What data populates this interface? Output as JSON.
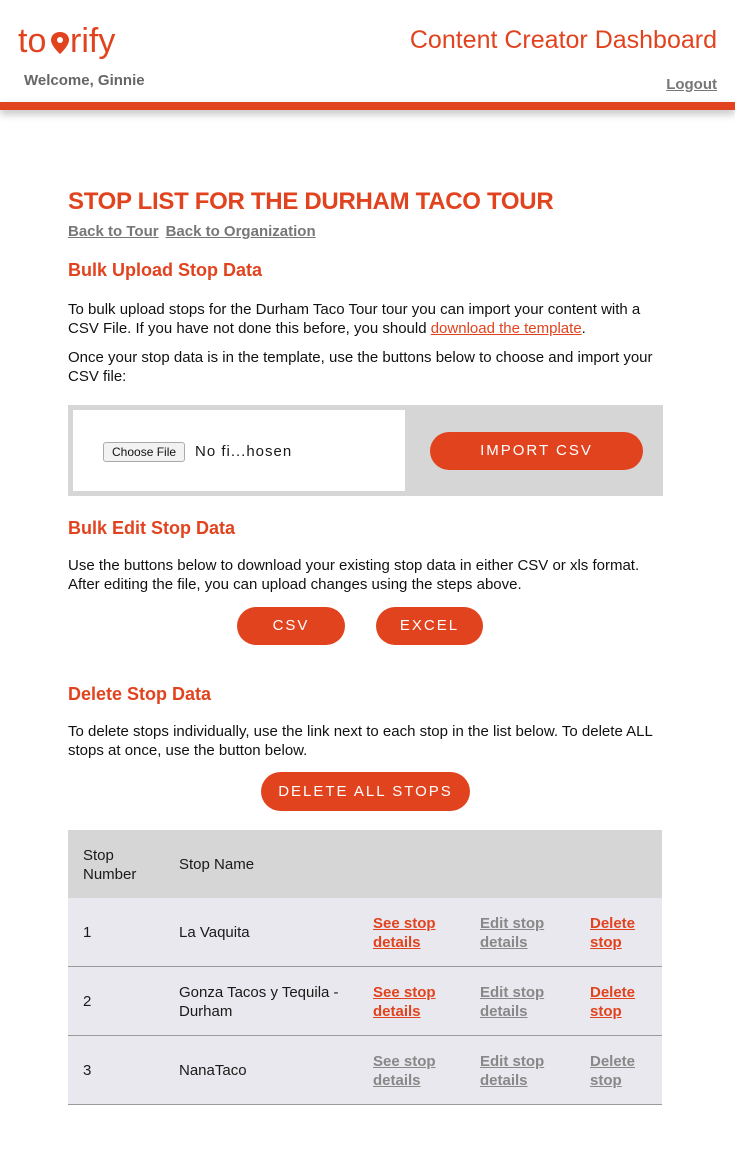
{
  "header": {
    "logo_text": "tourify",
    "welcome": "Welcome, Ginnie",
    "dashboard_title": "Content Creator Dashboard",
    "logout": "Logout"
  },
  "page": {
    "title": "STOP LIST FOR THE DURHAM TACO TOUR",
    "breadcrumbs": [
      "Back to Tour",
      "Back to Organization"
    ]
  },
  "bulk_upload": {
    "title": "Bulk Upload Stop Data",
    "para1_pre": "To bulk upload stops for the Durham Taco Tour tour you can import your content with a CSV File. If you have not done this before, you should ",
    "para1_link": "download the template",
    "para1_post": ".",
    "para2": "Once your stop data is in the template, use the buttons below to choose and import your CSV file:",
    "choose_file": "Choose File",
    "no_file": "No fi...hosen",
    "import_button": "IMPORT CSV"
  },
  "bulk_edit": {
    "title": "Bulk Edit Stop Data",
    "para": "Use the buttons below to download your existing stop data in either CSV or xls format. After editing the file, you can upload changes using the steps above.",
    "csv_button": "CSV",
    "excel_button": "EXCEL"
  },
  "delete": {
    "title": "Delete Stop Data",
    "para": "To delete stops individually, use the link next to each stop in the list below. To delete ALL stops at once, use the button below.",
    "delete_all_button": "DELETE ALL STOPS"
  },
  "table": {
    "headers": {
      "number": "Stop\nNumber",
      "name": "Stop Name"
    },
    "rows": [
      {
        "number": "1",
        "name": "La Vaquita",
        "see": "See stop\ndetails",
        "edit": "Edit stop\ndetails",
        "delete": "Delete\nstop",
        "see_active": true
      },
      {
        "number": "2",
        "name": "Gonza Tacos y Tequila -\nDurham",
        "see": "See stop\ndetails",
        "edit": "Edit stop\ndetails",
        "delete": "Delete\nstop",
        "see_active": true
      },
      {
        "number": "3",
        "name": "NanaTaco",
        "see": "See stop\ndetails",
        "edit": "Edit stop\ndetails",
        "delete": "Delete\nstop",
        "see_active": false
      }
    ]
  },
  "colors": {
    "accent": "#e2431f",
    "muted_link": "#777777",
    "panel": "#d6d6d6",
    "row": "#e8e8ee"
  }
}
